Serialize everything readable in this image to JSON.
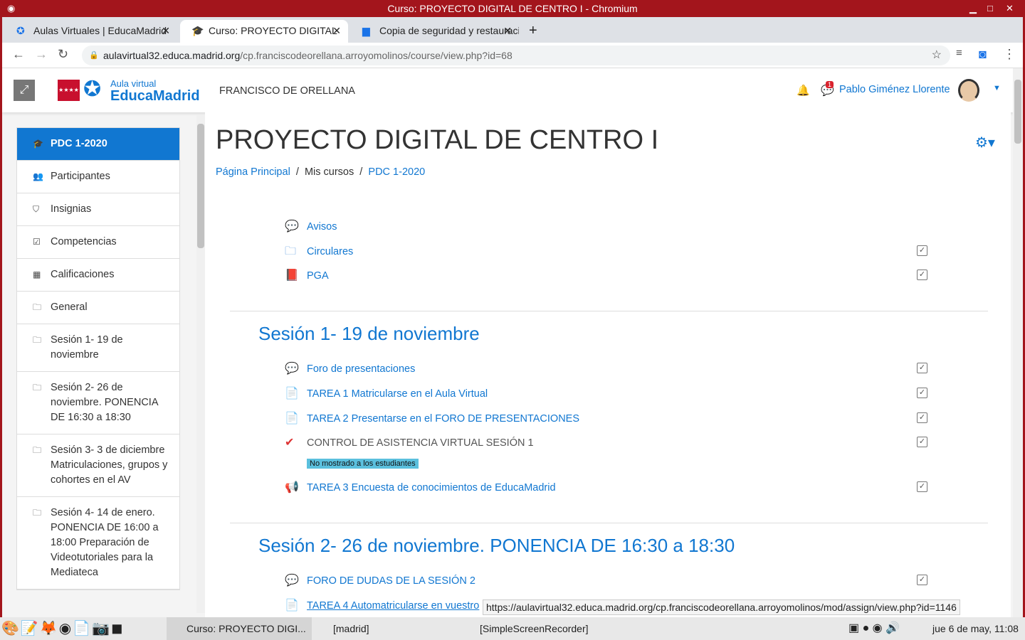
{
  "window": {
    "title": "Curso: PROYECTO DIGITAL DE CENTRO I - Chromium"
  },
  "tabs": [
    {
      "label": "Aulas Virtuales | EducaMadrid"
    },
    {
      "label": "Curso: PROYECTO DIGITAL"
    },
    {
      "label": "Copia de seguridad y restauración"
    }
  ],
  "address": {
    "domain": "aulavirtual32.educa.madrid.org",
    "path": "/cp.franciscodeorellana.arroyomolinos/course/view.php?id=68"
  },
  "header": {
    "logo_small": "Aula virtual",
    "logo_big": "EducaMadrid",
    "site": "FRANCISCO DE ORELLANA",
    "notif_count": "1",
    "user": "Pablo Giménez Llorente"
  },
  "sidebar": {
    "items": [
      {
        "label": "PDC 1-2020",
        "icon": "graduation-cap"
      },
      {
        "label": "Participantes",
        "icon": "users"
      },
      {
        "label": "Insignias",
        "icon": "shield"
      },
      {
        "label": "Competencias",
        "icon": "check-square"
      },
      {
        "label": "Calificaciones",
        "icon": "table"
      },
      {
        "label": "General",
        "icon": "folder"
      },
      {
        "label": "Sesión 1- 19 de noviembre",
        "icon": "folder"
      },
      {
        "label": "Sesión 2- 26 de noviembre. PONENCIA DE 16:30 a 18:30",
        "icon": "folder"
      },
      {
        "label": "Sesión 3- 3 de diciembre Matriculaciones, grupos y cohortes en el AV",
        "icon": "folder"
      },
      {
        "label": "Sesión 4- 14 de enero. PONENCIA DE 16:00 a 18:00 Preparación de Videotutoriales para la Mediateca",
        "icon": "folder"
      }
    ]
  },
  "main": {
    "title": "PROYECTO DIGITAL DE CENTRO I",
    "breadcrumb": [
      "Página Principal",
      "Mis cursos",
      "PDC 1-2020"
    ],
    "general": [
      {
        "label": "Avisos",
        "icon": "forum"
      },
      {
        "label": "Circulares",
        "icon": "folder"
      },
      {
        "label": "PGA",
        "icon": "pdf"
      }
    ],
    "sections": [
      {
        "title": "Sesión 1- 19 de noviembre",
        "activities": [
          {
            "label": "Foro de presentaciones",
            "icon": "forum"
          },
          {
            "label": "TAREA 1 Matricularse en el Aula Virtual",
            "icon": "assign"
          },
          {
            "label": "TAREA 2 Presentarse en el FORO DE PRESENTACIONES",
            "icon": "assign"
          },
          {
            "label": "CONTROL DE ASISTENCIA VIRTUAL SESIÓN 1",
            "icon": "attendance",
            "badge": "No mostrado a los estudiantes"
          },
          {
            "label": "TAREA 3 Encuesta de conocimientos de EducaMadrid",
            "icon": "feedback"
          }
        ]
      },
      {
        "title": "Sesión 2- 26 de noviembre. PONENCIA DE 16:30 a 18:30",
        "activities": [
          {
            "label": "FORO DE DUDAS DE LA SESIÓN 2",
            "icon": "forum"
          },
          {
            "label": "TAREA 4 Automatricularse en vuestro",
            "icon": "assign"
          }
        ]
      }
    ]
  },
  "status_url": "https://aulavirtual32.educa.madrid.org/cp.franciscodeorellana.arroyomolinos/mod/assign/view.php?id=1146",
  "taskbar": {
    "windows": [
      "Curso: PROYECTO DIGI...",
      "[madrid]",
      "[SimpleScreenRecorder]"
    ],
    "clock": "jue 6 de may, 11:08"
  }
}
